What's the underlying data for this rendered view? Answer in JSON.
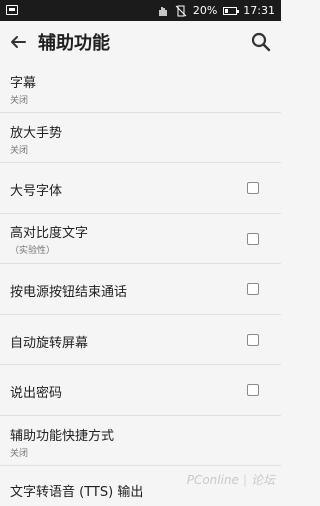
{
  "status_bar": {
    "notification_icon": "app-notification-icon",
    "hand_icon": "hand-icon",
    "mute_icon": "vibrate-off-icon",
    "battery_percent": "20%",
    "battery_icon": "battery-icon",
    "time": "17:31"
  },
  "app_bar": {
    "back_icon": "back-arrow-icon",
    "title": "辅助功能",
    "search_icon": "search-icon"
  },
  "items": [
    {
      "label": "字幕",
      "subtitle": "关闭",
      "has_checkbox": false
    },
    {
      "label": "放大手势",
      "subtitle": "关闭",
      "has_checkbox": false
    },
    {
      "label": "大号字体",
      "subtitle": "",
      "has_checkbox": true,
      "checked": false
    },
    {
      "label": "高对比度文字",
      "subtitle": "（实验性）",
      "has_checkbox": true,
      "checked": false
    },
    {
      "label": "按电源按钮结束通话",
      "subtitle": "",
      "has_checkbox": true,
      "checked": false
    },
    {
      "label": "自动旋转屏幕",
      "subtitle": "",
      "has_checkbox": true,
      "checked": false
    },
    {
      "label": "说出密码",
      "subtitle": "",
      "has_checkbox": true,
      "checked": false
    },
    {
      "label": "辅助功能快捷方式",
      "subtitle": "关闭",
      "has_checkbox": false
    },
    {
      "label": "文字转语音 (TTS) 输出",
      "subtitle": "",
      "has_checkbox": false
    }
  ],
  "watermark": {
    "brand": "PConline",
    "separator": "|",
    "forum": "论坛"
  }
}
